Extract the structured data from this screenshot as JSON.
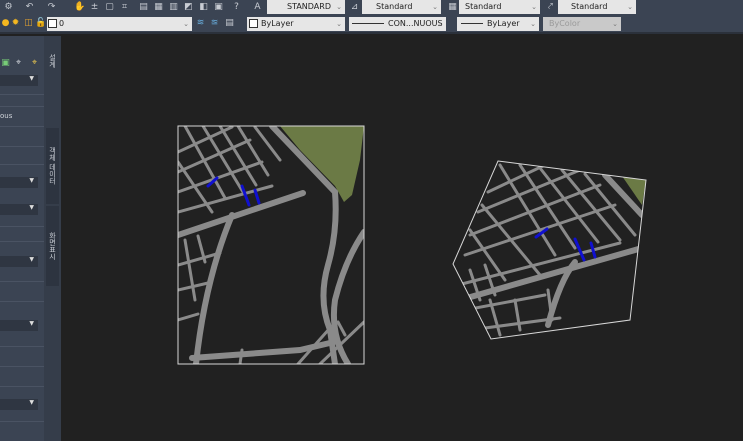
{
  "toolbar_row1": {
    "text_style": "STANDARD",
    "dim_style": "Standard",
    "table_style": "Standard",
    "multileader_style": "Standard"
  },
  "toolbar_row2": {
    "layer": "0",
    "color": "ByLayer",
    "linetype": "CON...NUOUS",
    "lineweight": "ByLayer",
    "plot_style": "ByColor"
  },
  "palette": {
    "partial_value": "ous"
  },
  "side_tabs": [
    "설계",
    "객체 데이터",
    "화면표시"
  ],
  "colors": {
    "road": "#8a8a8a",
    "park": "#6b7a45",
    "marker": "#1010d0",
    "frame": "#d8d8d8"
  }
}
